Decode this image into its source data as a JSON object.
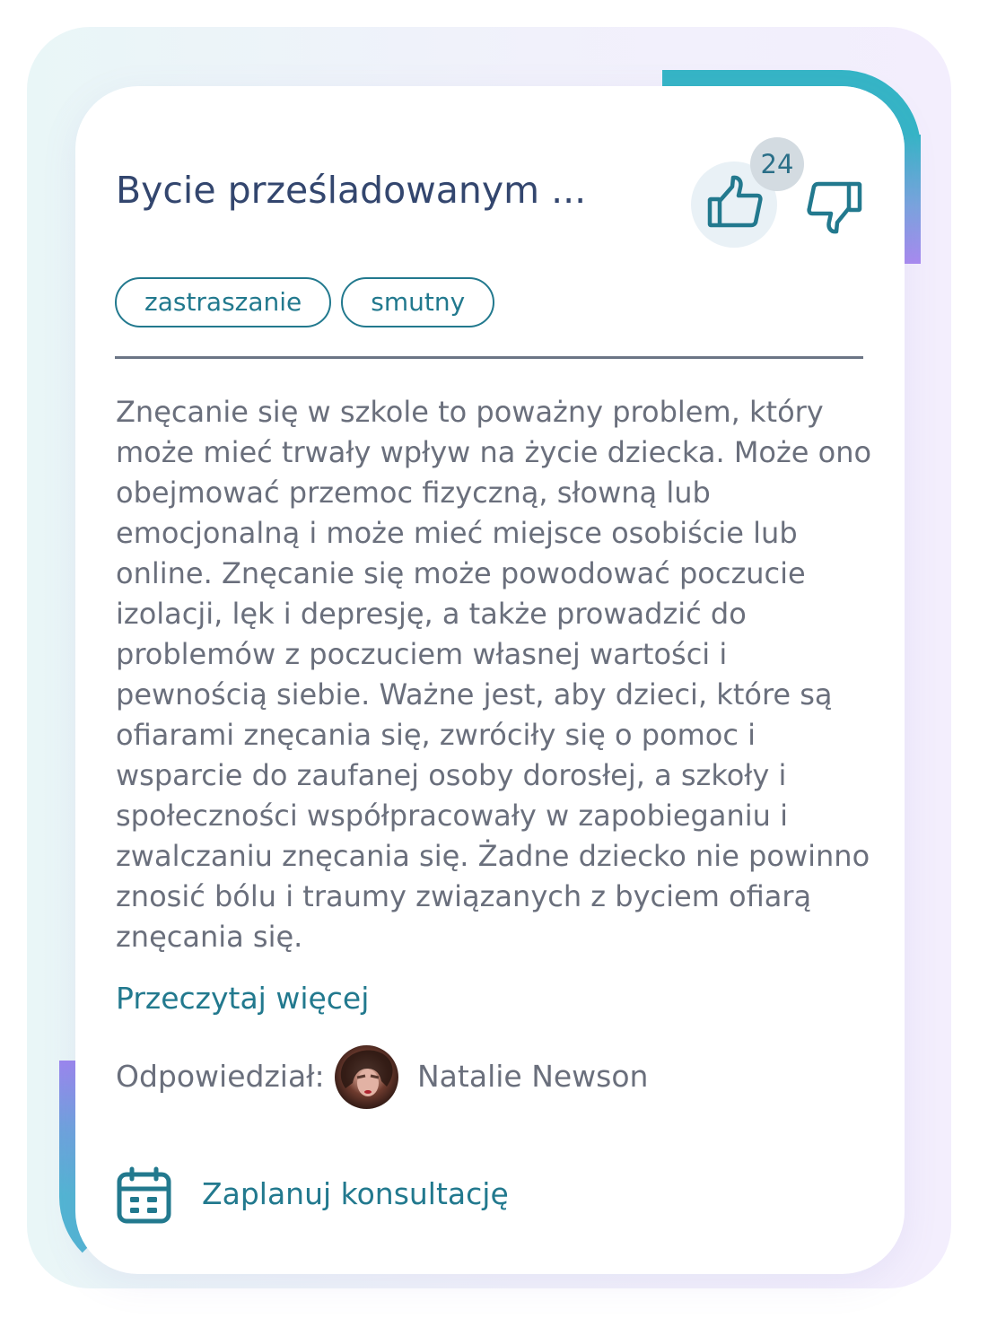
{
  "card": {
    "title": "Bycie prześladowanym  ...",
    "likes_count": "24",
    "tags": [
      "zastraszanie",
      "smutny"
    ],
    "body": "Znęcanie się w szkole to poważny problem, który może mieć trwały wpływ na życie dziecka. Może ono obejmować przemoc fizyczną, słowną lub emocjonalną i może mieć miejsce osobiście lub online. Znęcanie się może powodować poczucie izolacji, lęk i depresję, a także prowadzić do problemów z poczuciem własnej wartości i pewnością siebie. Ważne jest, aby dzieci, które są ofiarami znęcania się, zwróciły się o pomoc i wsparcie do zaufanej osoby dorosłej, a szkoły i społeczności współpracowały w zapobieganiu i zwalczaniu znęcania się. Żadne dziecko nie powinno znosić bólu i traumy związanych z byciem ofiarą znęcania się.",
    "read_more": "Przeczytaj więcej",
    "answered_by_label": "Odpowiedział:",
    "author_name": "Natalie Newson",
    "schedule_label": "Zaplanuj konsultację"
  },
  "icons": {
    "like": "thumbs-up-icon",
    "dislike": "thumbs-down-icon",
    "calendar": "calendar-icon",
    "avatar": "author-avatar"
  },
  "colors": {
    "accent": "#22798e",
    "title": "#33466e",
    "body_text": "#6a6f7c",
    "badge_bg": "#d3dbe1",
    "like_bg": "#e9f1f6",
    "frame_teal": "#35b5c6",
    "frame_purple": "#a98af0"
  }
}
